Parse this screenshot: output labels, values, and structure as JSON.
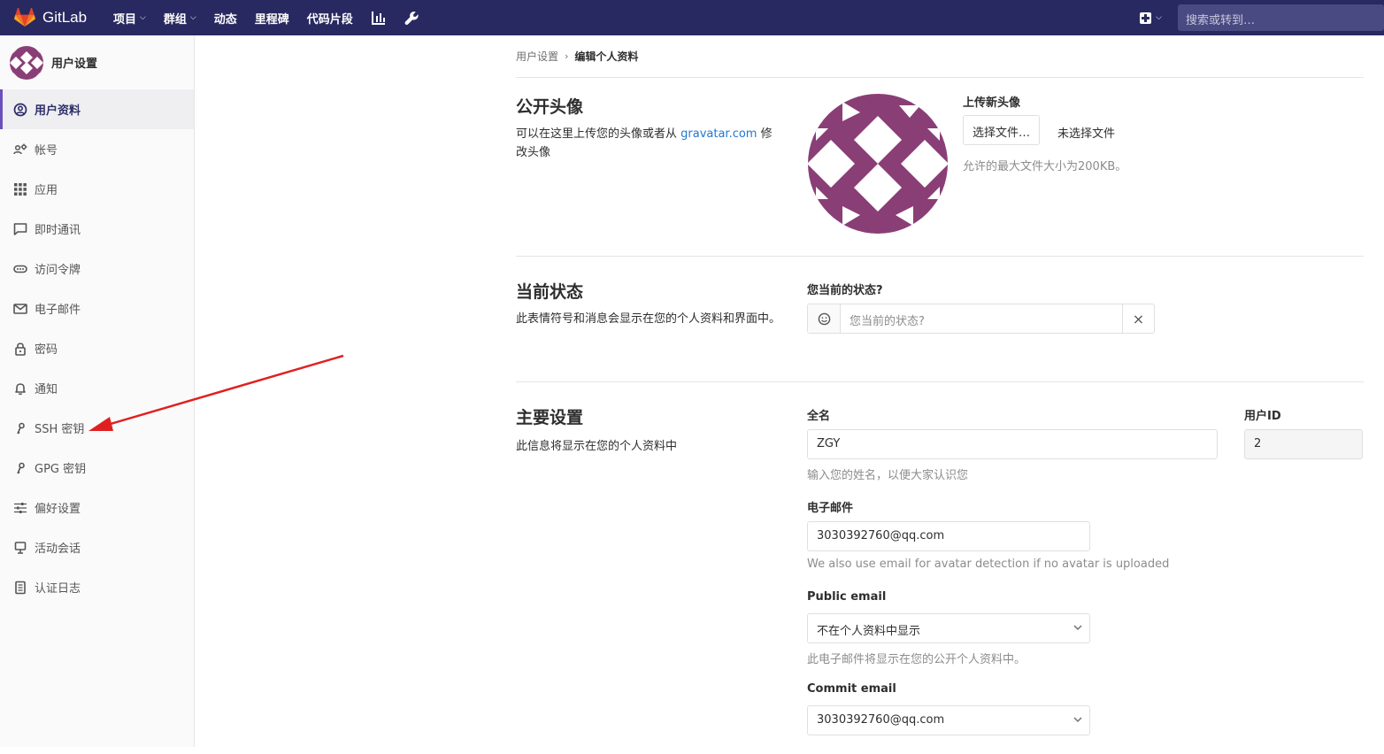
{
  "topbar": {
    "brand": "GitLab",
    "nav": [
      {
        "label": "项目",
        "has_dropdown": true
      },
      {
        "label": "群组",
        "has_dropdown": true
      },
      {
        "label": "动态",
        "has_dropdown": false
      },
      {
        "label": "里程碑",
        "has_dropdown": false
      },
      {
        "label": "代码片段",
        "has_dropdown": false
      }
    ],
    "icons": [
      "chart-icon",
      "wrench-icon"
    ],
    "search_placeholder": "搜索或转到…"
  },
  "sidebar": {
    "title": "用户设置",
    "items": [
      {
        "label": "用户资料",
        "icon": "user-circle-icon",
        "active": true
      },
      {
        "label": "帐号",
        "icon": "account-icon",
        "active": false
      },
      {
        "label": "应用",
        "icon": "grid-icon",
        "active": false
      },
      {
        "label": "即时通讯",
        "icon": "chat-icon",
        "active": false
      },
      {
        "label": "访问令牌",
        "icon": "token-icon",
        "active": false
      },
      {
        "label": "电子邮件",
        "icon": "envelope-icon",
        "active": false
      },
      {
        "label": "密码",
        "icon": "lock-icon",
        "active": false
      },
      {
        "label": "通知",
        "icon": "bell-icon",
        "active": false
      },
      {
        "label": "SSH 密钥",
        "icon": "key-icon",
        "active": false
      },
      {
        "label": "GPG 密钥",
        "icon": "key-icon",
        "active": false
      },
      {
        "label": "偏好设置",
        "icon": "sliders-icon",
        "active": false
      },
      {
        "label": "活动会话",
        "icon": "monitor-icon",
        "active": false
      },
      {
        "label": "认证日志",
        "icon": "log-icon",
        "active": false
      }
    ]
  },
  "breadcrumb": {
    "parent": "用户设置",
    "separator": "›",
    "current": "编辑个人资料"
  },
  "avatar_section": {
    "title": "公开头像",
    "desc_before": "可以在这里上传您的头像或者从 ",
    "desc_link": "gravatar.com",
    "desc_after": " 修改头像",
    "upload_label": "上传新头像",
    "choose_button": "选择文件…",
    "no_file": "未选择文件",
    "max_size_hint": "允许的最大文件大小为200KB。",
    "avatar_color": "#8a3e76"
  },
  "status_section": {
    "title": "当前状态",
    "desc": "此表情符号和消息会显示在您的个人资料和界面中。",
    "field_label": "您当前的状态?",
    "placeholder": "您当前的状态?",
    "clear_icon": "×"
  },
  "main_section": {
    "title": "主要设置",
    "desc": "此信息将显示在您的个人资料中",
    "fullname_label": "全名",
    "fullname_value": "ZGY",
    "fullname_hint": "输入您的姓名，以便大家认识您",
    "userid_label": "用户ID",
    "userid_value": "2",
    "email_label": "电子邮件",
    "email_value": "3030392760@qq.com",
    "email_hint": "We also use email for avatar detection if no avatar is uploaded",
    "public_email_label": "Public email",
    "public_email_value": "不在个人资料中显示",
    "public_email_hint": "此电子邮件将显示在您的公开个人资料中。",
    "commit_email_label": "Commit email",
    "commit_email_value": "3030392760@qq.com"
  },
  "colors": {
    "navbar": "#292961",
    "accent": "#6b4fbb",
    "link": "#1f78d1",
    "annotation_arrow": "#e02020"
  }
}
